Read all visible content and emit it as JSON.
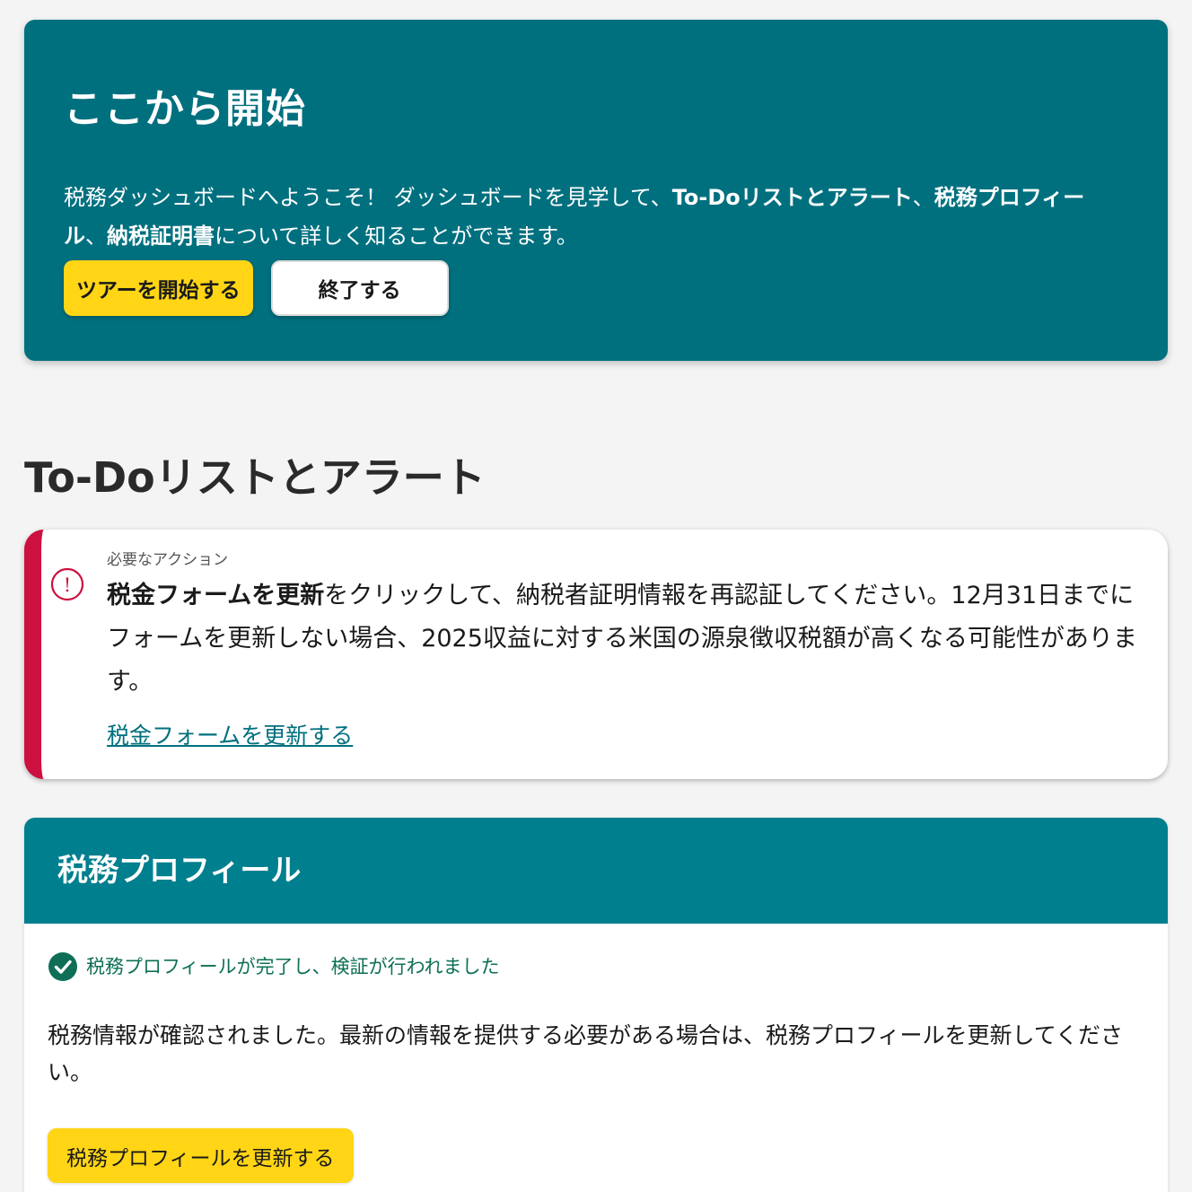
{
  "intro": {
    "title": "ここから開始",
    "text_part1": "税務ダッシュボードへようこそ！ ダッシュボードを見学して、",
    "text_bold1": "To-Doリストとアラート",
    "text_part2": "、",
    "text_bold2": "税務プロフィール",
    "text_part3": "、",
    "text_bold3": "納税証明書",
    "text_part4": "について詳しく知ることができます。",
    "start_tour_label": "ツアーを開始する",
    "exit_label": "終了する"
  },
  "todo": {
    "heading": "To-Doリストとアラート",
    "alert": {
      "icon": "exclamation-circle-icon",
      "icon_text": "!",
      "eyebrow": "必要なアクション",
      "body_bold": "税金フォームを更新",
      "body_rest": "をクリックして、納税者証明情報を再認証してください。12月31日までにフォームを更新しない場合、2025収益に対する米国の源泉徴収税額が高くなる可能性があります。",
      "link_label": "税金フォームを更新する"
    }
  },
  "tax_profile": {
    "title": "税務プロフィール",
    "status_icon": "check-circle-icon",
    "status_text": "税務プロフィールが完了し、検証が行われました",
    "description": "税務情報が確認されました。最新の情報を提供する必要がある場合は、税務プロフィールを更新してください。",
    "update_button_label": "税務プロフィールを更新する"
  },
  "colors": {
    "page_background": "#f4f4f4",
    "intro_background": "#00707f",
    "profile_header": "#007f8f",
    "accent_yellow": "#ffd515",
    "alert_red": "#cc1040",
    "success_green": "#0e6f56",
    "link_teal": "#00707f"
  }
}
